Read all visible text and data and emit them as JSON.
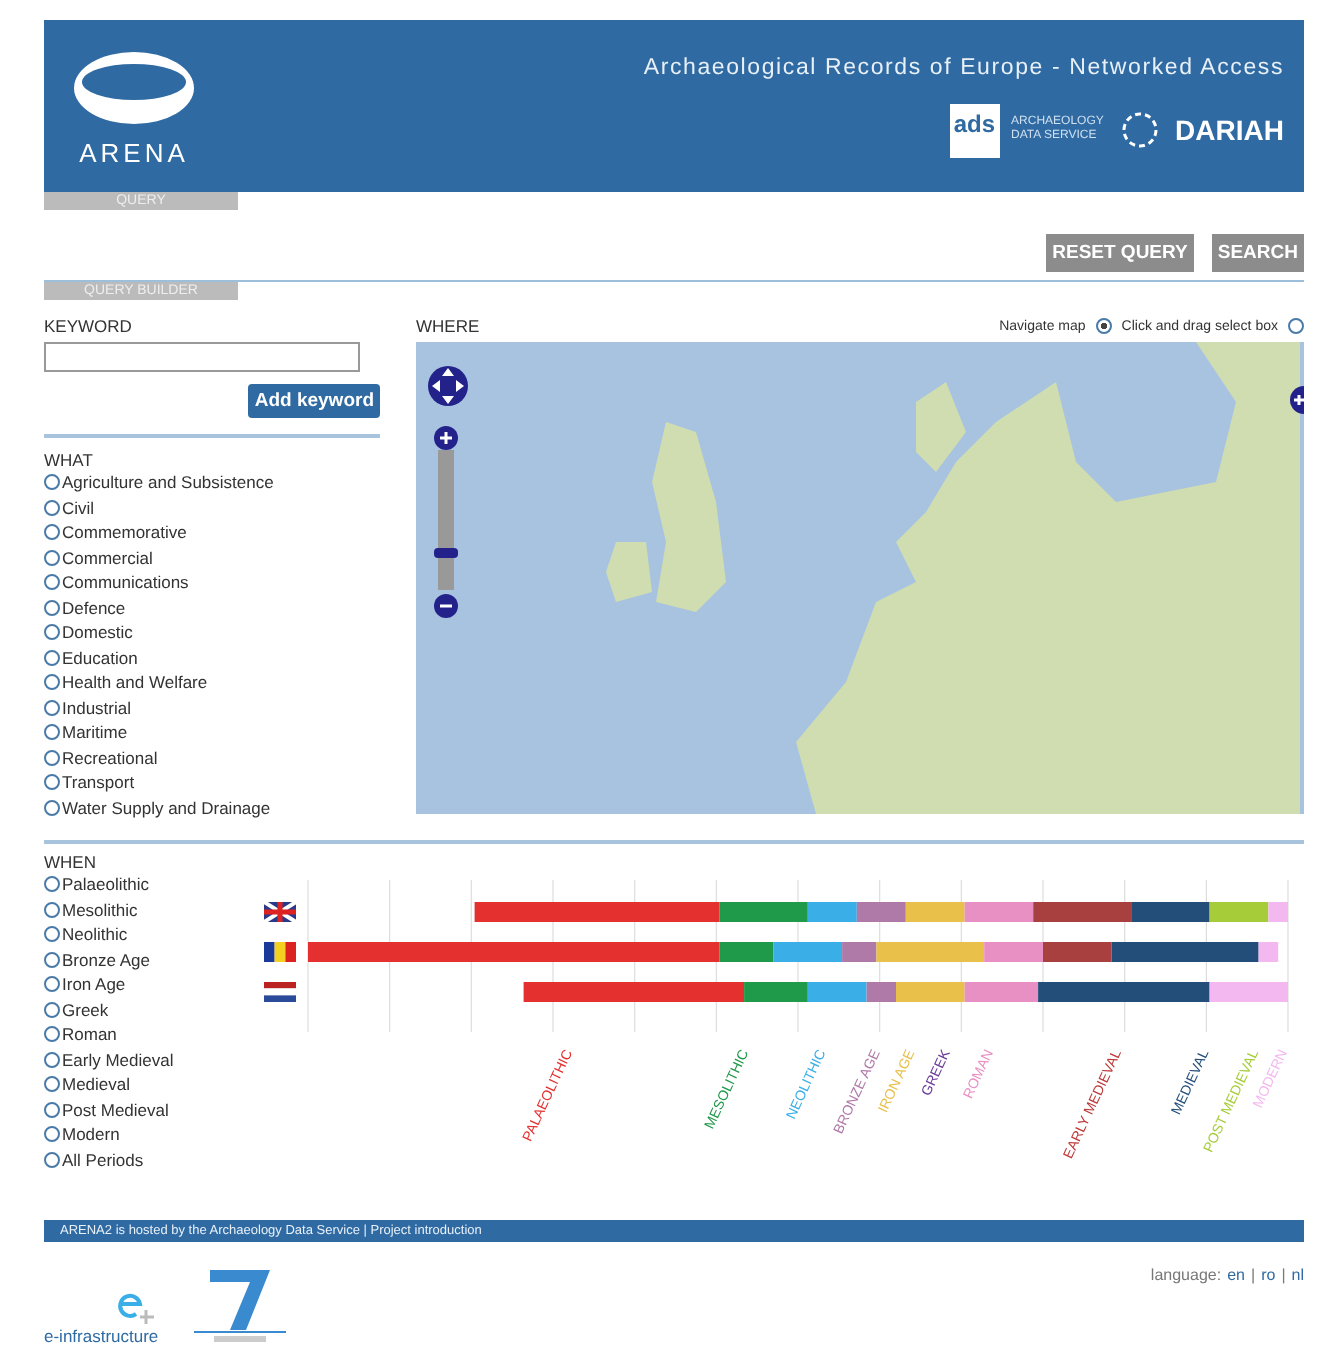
{
  "header": {
    "logo_text": "ARENA",
    "title": "Archaeological Records of Europe - Networked Access",
    "partner_ads": "ads",
    "partner_ads_name": "ARCHAEOLOGY DATA SERVICE",
    "partner_dariah": "DARIAH"
  },
  "query_tab": "QUERY",
  "buttons": [
    {
      "label": "RESET QUERY",
      "disabled": true
    },
    {
      "label": "SEARCH",
      "disabled": true
    }
  ],
  "query_builder_tab": "QUERY BUILDER",
  "keyword": {
    "label": "KEYWORD",
    "button": "Add keyword"
  },
  "what": {
    "label": "WHAT",
    "items": [
      {
        "label": "Agriculture and Subsistence",
        "selected": false
      },
      {
        "label": "Civil",
        "selected": false
      },
      {
        "label": "Commemorative",
        "selected": false
      },
      {
        "label": "Commercial",
        "selected": false
      },
      {
        "label": "Communications",
        "selected": false
      },
      {
        "label": "Defence",
        "selected": false
      },
      {
        "label": "Domestic",
        "selected": false
      },
      {
        "label": "Education",
        "selected": false
      },
      {
        "label": "Health and Welfare",
        "selected": false
      },
      {
        "label": "Industrial",
        "selected": false
      },
      {
        "label": "Maritime",
        "selected": false
      },
      {
        "label": "Recreational",
        "selected": false
      },
      {
        "label": "Transport",
        "selected": false
      },
      {
        "label": "Water Supply and Drainage",
        "selected": false
      }
    ]
  },
  "where": {
    "label": "WHERE",
    "zoom": {
      "level": 0.25
    },
    "modes": [
      {
        "label": "Navigate map",
        "selected": true
      },
      {
        "label": "Click and drag select box",
        "selected": false
      }
    ]
  },
  "when": {
    "label": "WHEN",
    "items": [
      {
        "label": "Palaeolithic",
        "selected": false
      },
      {
        "label": "Mesolithic",
        "selected": false
      },
      {
        "label": "Neolithic",
        "selected": false
      },
      {
        "label": "Bronze Age",
        "selected": false
      },
      {
        "label": "Iron Age",
        "selected": false
      },
      {
        "label": "Greek",
        "selected": false
      },
      {
        "label": "Roman",
        "selected": false
      },
      {
        "label": "Early Medieval",
        "selected": false
      },
      {
        "label": "Medieval",
        "selected": false
      },
      {
        "label": "Post Medieval",
        "selected": false
      },
      {
        "label": "Modern",
        "selected": false
      },
      {
        "label": "All Periods",
        "selected": false
      }
    ]
  },
  "timeline_periods": [
    {
      "label": "PALAEOLITHIC",
      "color": "#e53030"
    },
    {
      "label": "MESOLITHIC",
      "color": "#1f9a4a"
    },
    {
      "label": "NEOLITHIC",
      "color": "#3aaee6"
    },
    {
      "label": "BRONZE AGE",
      "color": "#b07aa8"
    },
    {
      "label": "IRON AGE",
      "color": "#e8c04a"
    },
    {
      "label": "GREEK",
      "color": "#6a3a9a"
    },
    {
      "label": "ROMAN",
      "color": "#e890c4"
    },
    {
      "label": "EARLY MEDIEVAL",
      "color": "#c03838"
    },
    {
      "label": "MEDIEVAL",
      "color": "#234e7a"
    },
    {
      "label": "POST MEDIEVAL",
      "color": "#a6cc3a"
    },
    {
      "label": "MODERN",
      "color": "#f4b8f0"
    }
  ],
  "footer": {
    "text": "ARENA2 is hosted by the Archaeology Data Service | Project introduction",
    "einfra": "e-infrastructure",
    "language_label": "language:",
    "languages": [
      "en",
      "ro",
      "nl"
    ],
    "separators": [
      "|",
      "|"
    ]
  }
}
